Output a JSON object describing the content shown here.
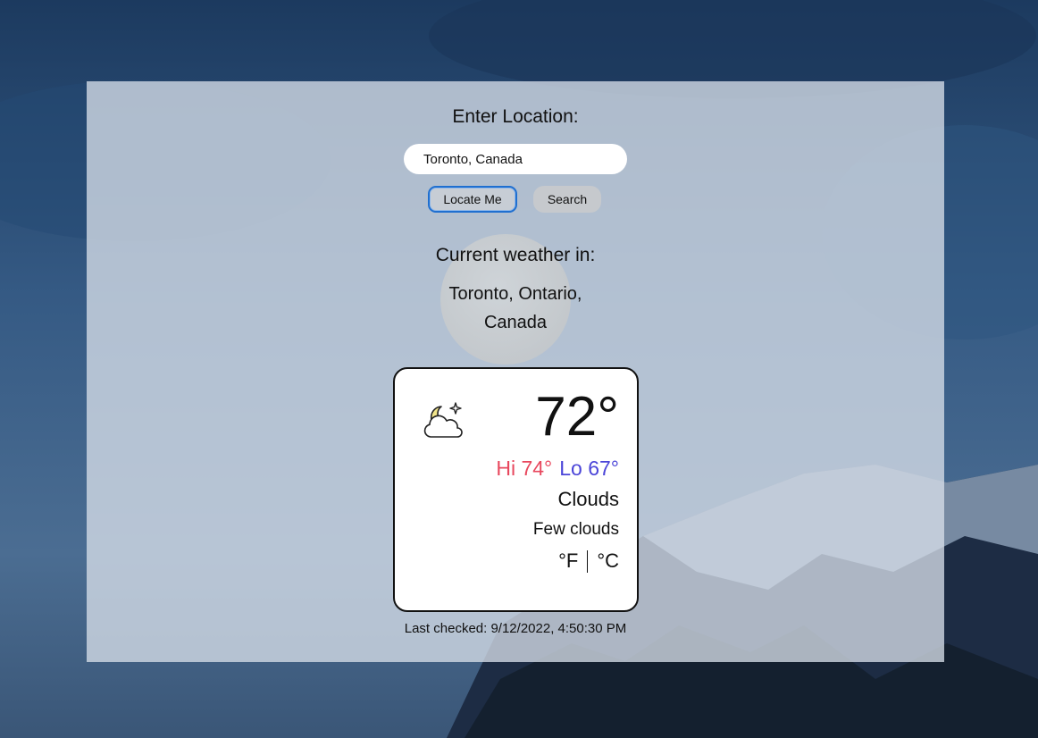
{
  "search": {
    "prompt": "Enter Location:",
    "value": "Toronto, Canada",
    "locate_label": "Locate Me",
    "search_label": "Search"
  },
  "current": {
    "heading": "Current weather in:",
    "location": "Toronto, Ontario, Canada"
  },
  "weather": {
    "icon": "cloud-moon-icon",
    "temperature": "72°",
    "hi": "Hi 74°",
    "lo": "Lo 67°",
    "condition": "Clouds",
    "description": "Few clouds",
    "unit_f": "°F",
    "unit_c": "°C"
  },
  "footer": {
    "last_checked": "Last checked: 9/12/2022, 4:50:30 PM"
  },
  "colors": {
    "hi": "#e8485e",
    "lo": "#4b45d8",
    "focus_ring": "#1f6fd0"
  }
}
